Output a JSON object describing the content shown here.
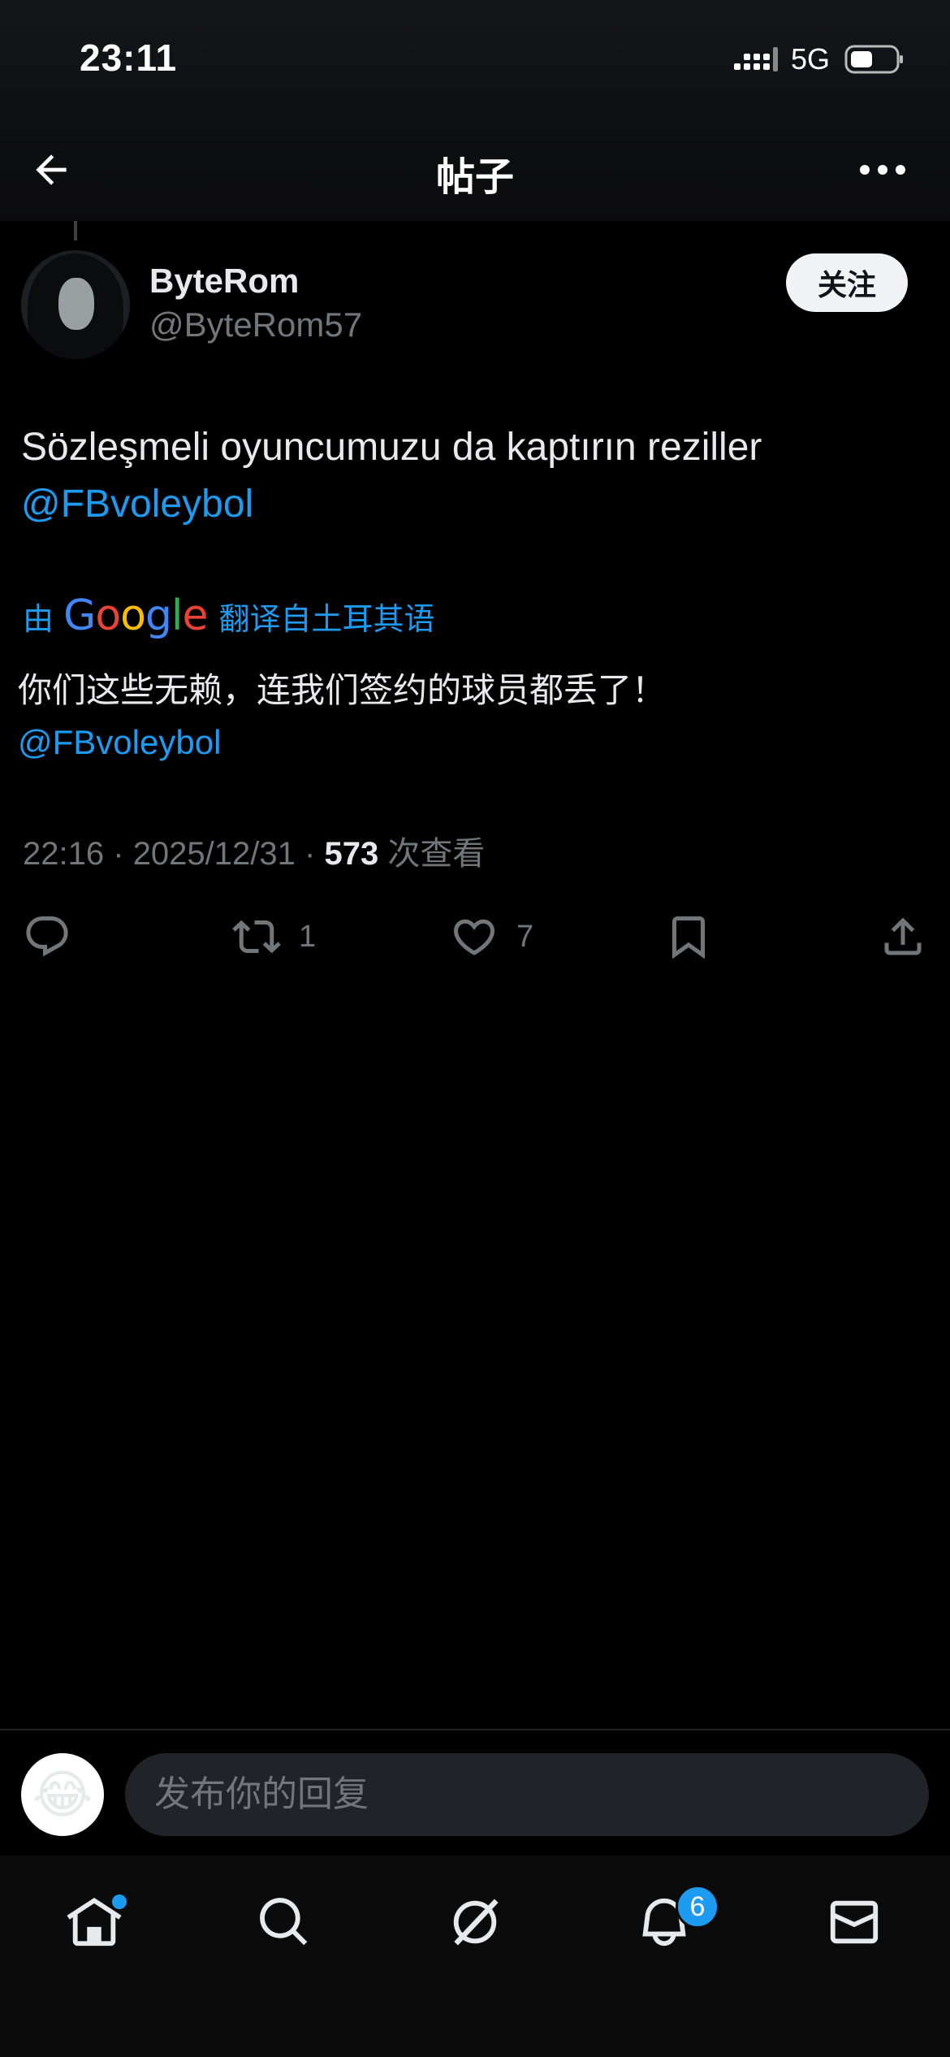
{
  "status_bar": {
    "time": "23:11",
    "network": "5G",
    "icons": [
      "signal-icon",
      "battery-icon"
    ]
  },
  "header": {
    "title": "帖子",
    "icons": [
      "back-arrow-icon",
      "more-icon"
    ]
  },
  "post": {
    "author": {
      "name": "ByteRom",
      "handle": "@ByteRom57"
    },
    "follow_label": "关注",
    "text": "Sözleşmeli oyuncumuzu da kaptırın reziller",
    "mention": "@FBvoleybol",
    "translation": {
      "prefix": "由",
      "provider": "Google",
      "label": "翻译自土耳其语",
      "text": "你们这些无赖，连我们签约的球员都丢了！",
      "mention": "@FBvoleybol"
    },
    "meta": {
      "time": "22:16",
      "date": "2025/12/31",
      "separator": "·",
      "views": "573",
      "views_label": "次查看"
    },
    "actions": {
      "reply_count": "",
      "retweet_count": "1",
      "like_count": "7",
      "icons": [
        "reply-icon",
        "retweet-icon",
        "like-icon",
        "bookmark-icon",
        "share-icon"
      ]
    }
  },
  "composer": {
    "placeholder": "发布你的回复",
    "avatar_emoji": "😂"
  },
  "bottom_nav": {
    "items": [
      "home-icon",
      "search-icon",
      "grok-icon",
      "notifications-icon",
      "messages-icon"
    ],
    "notification_count": "6"
  },
  "colors": {
    "accent": "#1d9bf0",
    "background": "#000000",
    "text_primary": "#e7e9ea",
    "text_secondary": "#71767b"
  }
}
